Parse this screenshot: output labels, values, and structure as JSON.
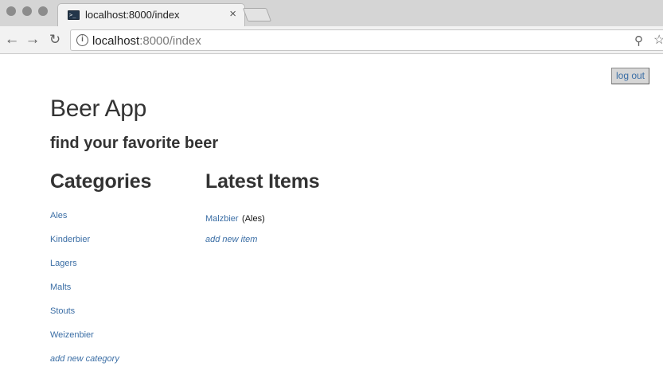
{
  "browser": {
    "tab_title": "localhost:8000/index",
    "tab_close": "×",
    "url_host": "localhost",
    "url_rest": ":8000/index",
    "favicon_text": ">_",
    "icons": {
      "back": "←",
      "forward": "→",
      "reload": "↻",
      "info": "i",
      "zoom": "⚲",
      "star": "☆"
    }
  },
  "header": {
    "logout_label": "log out",
    "title": "Beer App",
    "subtitle": "find your favorite beer"
  },
  "categories": {
    "heading": "Categories",
    "items": [
      "Ales",
      "Kinderbier",
      "Lagers",
      "Malts",
      "Stouts",
      "Weizenbier"
    ],
    "add_label": "add new category"
  },
  "latest": {
    "heading": "Latest Items",
    "items": [
      {
        "name": "Malzbier",
        "category": "(Ales)"
      }
    ],
    "add_label": "add new item"
  },
  "colors": {
    "link": "#3b6ea5",
    "heading": "#333333",
    "chrome": "#d5d5d5"
  }
}
